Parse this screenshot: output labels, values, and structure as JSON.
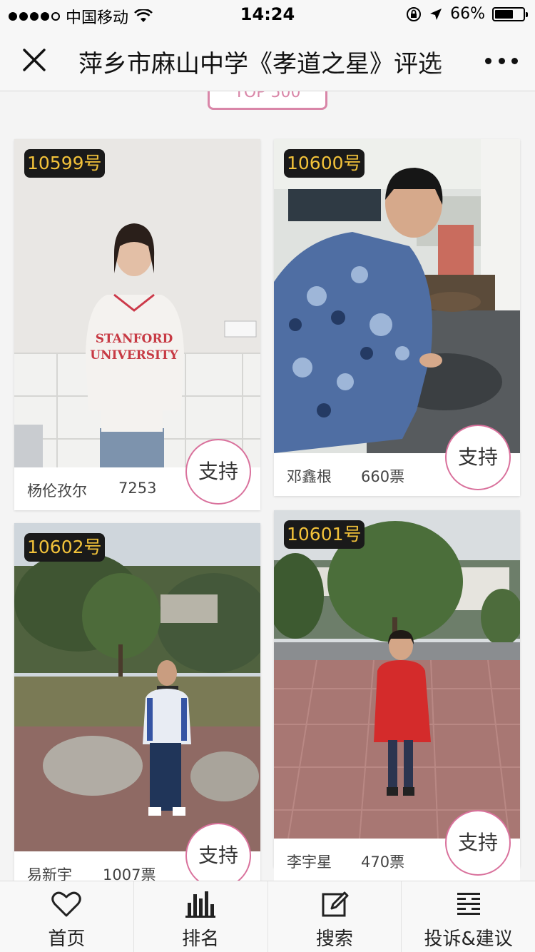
{
  "status_bar": {
    "carrier": "中国移动",
    "time": "14:24",
    "battery": "66%",
    "battery_level": 0.66
  },
  "nav": {
    "title": "萍乡市麻山中学《孝道之星》评选"
  },
  "ribbon": {
    "label": "TOP 500"
  },
  "candidates": [
    {
      "number": "10599号",
      "name": "杨伦孜尔",
      "votes": "7253",
      "support_label": "支持"
    },
    {
      "number": "10600号",
      "name": "邓鑫根",
      "votes": "660票",
      "support_label": "支持"
    },
    {
      "number": "10602号",
      "name": "易新宇",
      "votes": "1007票",
      "support_label": "支持"
    },
    {
      "number": "10601号",
      "name": "李宇星",
      "votes": "470票",
      "support_label": "支持"
    }
  ],
  "tabs": [
    {
      "label": "首页",
      "icon": "heart-icon"
    },
    {
      "label": "排名",
      "icon": "bar-chart-icon"
    },
    {
      "label": "搜索",
      "icon": "edit-icon"
    },
    {
      "label": "投诉&建议",
      "icon": "menu-lines-icon"
    }
  ],
  "colors": {
    "accent": "#d9719c",
    "badge_text": "#f2c23a",
    "badge_bg": "#1a1a1a"
  }
}
